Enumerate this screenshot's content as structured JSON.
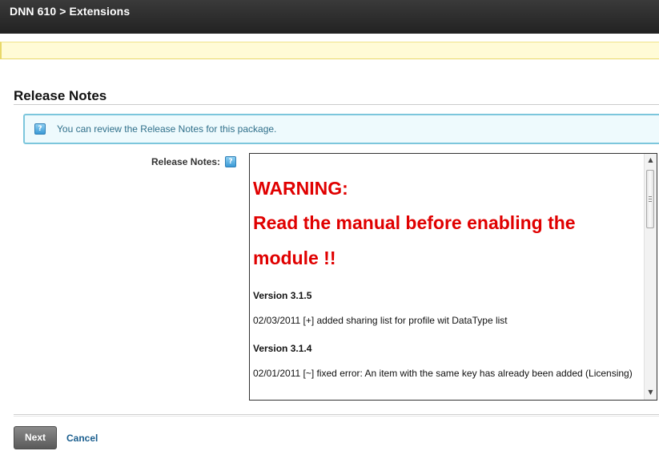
{
  "window": {
    "title": "DNN 610 > Extensions"
  },
  "section": {
    "title": "Release Notes"
  },
  "info": {
    "icon": "help-icon",
    "text": "You can review the Release Notes for this package."
  },
  "field": {
    "label": "Release Notes:",
    "help_icon": "help-icon"
  },
  "release_notes": {
    "warning_lines": [
      "WARNING:",
      "Read the manual before enabling the",
      "module !!"
    ],
    "versions": [
      {
        "version": "Version 3.1.5",
        "entry": "02/03/2011 [+] added sharing list for profile wit DataType list"
      },
      {
        "version": "Version 3.1.4",
        "entry": "02/01/2011 [~] fixed error: An item with the same key has already been added (Licensing)"
      }
    ]
  },
  "actions": {
    "next_label": "Next",
    "cancel_label": "Cancel"
  },
  "colors": {
    "warning": "#e00000",
    "info_border": "#7cc6dc",
    "info_text": "#2f6f8a",
    "link": "#1a5e8e"
  }
}
